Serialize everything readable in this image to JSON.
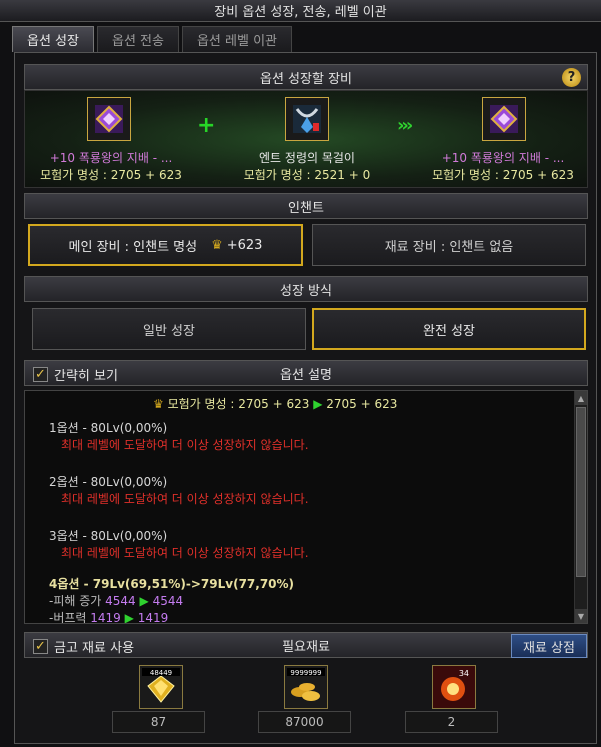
{
  "window": {
    "title": "장비 옵션 성장, 전송, 레벨 이관"
  },
  "tabs": [
    {
      "label": "옵션 성장"
    },
    {
      "label": "옵션 전송"
    },
    {
      "label": "옵션 레벨 이관"
    }
  ],
  "equip_section": {
    "title": "옵션 성장할 장비",
    "help": "?",
    "main": {
      "name": "+10 폭룡왕의 지배 - ...",
      "fame": "모험가 명성 : 2705 + 623"
    },
    "material": {
      "name": "엔트 정령의 목걸이",
      "fame": "모험가 명성 : 2521 + 0"
    },
    "result": {
      "name": "+10 폭룡왕의 지배 - ...",
      "fame": "모험가 명성 : 2705 + 623"
    }
  },
  "enchant": {
    "title": "인챈트",
    "main_label": "메인 장비 : 인챈트 명성",
    "main_value": "+623",
    "material_label": "재료 장비 : 인챈트 없음"
  },
  "growth": {
    "title": "성장 방식",
    "normal": "일반 성장",
    "full": "완전 성장"
  },
  "options": {
    "simple_view": "간략히 보기",
    "title": "옵션 설명",
    "fame_from": "모험가 명성 : 2705 + 623",
    "fame_to": "2705 + 623",
    "opt1": {
      "title": "1옵션 - 80Lv(0,00%)",
      "desc": "최대 레벨에 도달하여 더 이상 성장하지 않습니다."
    },
    "opt2": {
      "title": "2옵션 - 80Lv(0,00%)",
      "desc": "최대 레벨에 도달하여 더 이상 성장하지 않습니다."
    },
    "opt3": {
      "title": "3옵션 - 80Lv(0,00%)",
      "desc": "최대 레벨에 도달하여 더 이상 성장하지 않습니다."
    },
    "opt4": {
      "title": "4옵션 - 79Lv(69,51%)->79Lv(77,70%)",
      "dmg_label": "-피해 증가",
      "dmg_from": "4544",
      "dmg_to": "4544",
      "buff_label": "-버프력",
      "buff_from": "1419",
      "buff_to": "1419"
    }
  },
  "materials": {
    "vault": "금고 재료 사용",
    "title": "필요재료",
    "shop": "재료 상점",
    "items": [
      {
        "badge": "48449",
        "count": "87"
      },
      {
        "badge": "9999999",
        "count": "87000"
      },
      {
        "badge": "34",
        "count": "2"
      }
    ]
  },
  "colors": {
    "gold": "#d3a81e",
    "green": "#2fd22f",
    "red": "#e0302a",
    "purple": "#c47cf0"
  }
}
